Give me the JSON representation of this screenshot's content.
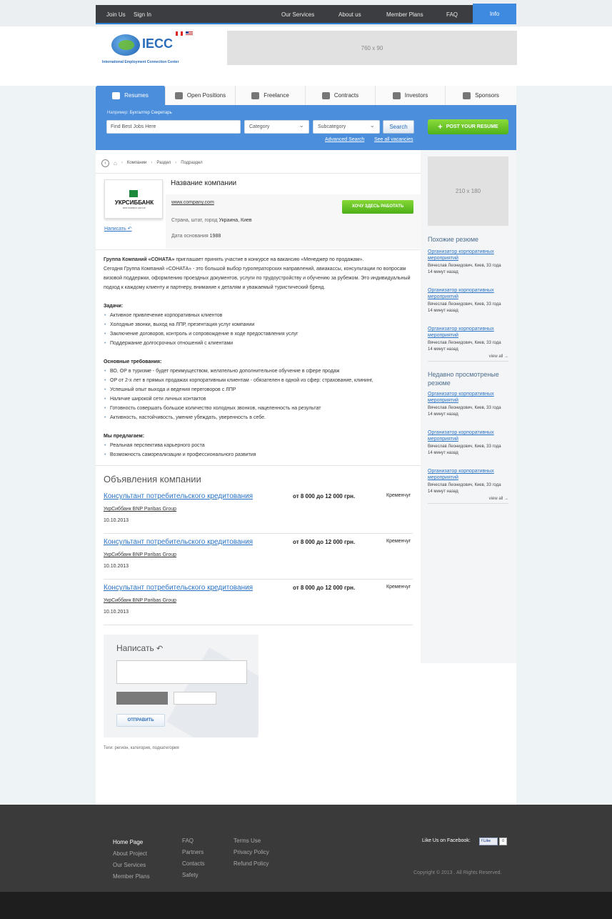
{
  "topnav": {
    "left": [
      "Join Us",
      "Sign In"
    ],
    "right": [
      "Our Services",
      "About us",
      "Member Plans",
      "FAQ"
    ],
    "info": "Info"
  },
  "header": {
    "logo_text": "IECC",
    "logo_sub": "International Employment Connection Center",
    "banner": "760 x 90"
  },
  "tabs": [
    {
      "label": "Resumes",
      "icon": "resume-icon"
    },
    {
      "label": "Open Positions",
      "icon": "person-icon"
    },
    {
      "label": "Freelance",
      "icon": "freelance-icon"
    },
    {
      "label": "Contracts",
      "icon": "contract-icon"
    },
    {
      "label": "Investors",
      "icon": "bulb-icon"
    },
    {
      "label": "Sponsors",
      "icon": "handshake-icon"
    }
  ],
  "search": {
    "hint_prefix": "Например:",
    "hint_1": "Бухгалтер",
    "hint_2": "Секретарь",
    "placeholder": "Find Best Jobs Here",
    "category": "Category",
    "subcategory": "Subcategory",
    "button": "Search",
    "advanced": "Advanced Search",
    "see_all": "See all vacancies",
    "post": "POST YOUR RESUME"
  },
  "breadcrumb": [
    "Компании",
    "Раздел",
    "Подраздел"
  ],
  "company": {
    "logo_name": "УКРСИББАНК",
    "logo_sub": "BNP PARIBAS GROUP",
    "write": "Написать",
    "name": "Название компании",
    "site": "www.company.com",
    "loc_label": "Страна, штат, город",
    "loc_value": "Украина, Киев",
    "date_label": "Дата основания",
    "date_value": "1988",
    "button": "ХОЧУ ЗДЕСЬ РАБОТАТЬ"
  },
  "description": {
    "intro_bold": "Группа Компаний «СОНАТА»",
    "intro_rest": " приглашает принять участие в конкурсе на вакансию «Менеджер по продажам».",
    "para": "Сегодня Группа Компаний «СОНАТА» - это большой выбор туроператорских направлений, авиакассы, консультации по вопросам визовой поддержки, оформлению проездных документов, услуги по трудоустройству и обучению за рубежом. Это индивидуальный подход к каждому клиенту и партнеру, внимание к деталям и уважаемый туристический бренд.",
    "tasks_title": "Задачи:",
    "tasks": [
      "Активное привлечение корпоративных клиентов",
      "Холодные звонки, выход на ЛПР, презентация услуг компании",
      "Заключение договоров, контроль и сопровождение в ходе предоставления услуг",
      "Поддержание долгосрочных отношений с клиентами"
    ],
    "req_title": "Основные требования:",
    "req": [
      "ВО, ОР в туризме - будет преимуществом, желательно дополнительное обучение в сфере продаж",
      "ОР от 2-х лет в прямых продажах корпоративным клиентам - обязателен в одной из сфер: страхование, клининг,",
      "Успешный опыт выхода и ведения переговоров с ЛПР",
      "Наличие широкой сети личных контактов",
      "Готовность совершать большое количество холодных звонков, нацеленность на результат",
      "Активность, настойчивость, умение убеждать, уверенность в себе."
    ],
    "offer_title": "Мы предлагаем:",
    "offer": [
      "Реальная перспектива карьерного роста",
      "Возможность самореализации и профессионального развития"
    ]
  },
  "announcements": {
    "title": "Объявления компании",
    "items": [
      {
        "title": "Консультант потребительского кредитования",
        "salary": "от 8 000 до 12 000 грн.",
        "city": "Кременчуг",
        "company": "УкрСиббанк BNP Paribas Group",
        "date": "10.10.2013"
      },
      {
        "title": "Консультант потребительского кредитования",
        "salary": "от 8 000 до 12 000 грн.",
        "city": "Кременчуг",
        "company": "УкрСиббанк BNP Paribas Group",
        "date": "10.10.2013"
      },
      {
        "title": "Консультант потребительского кредитования",
        "salary": "от 8 000 до 12 000 грн.",
        "city": "Кременчуг",
        "company": "УкрСиббанк BNP Paribas Group",
        "date": "10.10.2013"
      }
    ]
  },
  "form": {
    "title": "Написать",
    "send": "ОТПРАВИТЬ",
    "tags": "Теги: регион, категория, подкатегория"
  },
  "sidebar": {
    "ad": "210 x 180",
    "similar_title": "Похожие резюме",
    "recent_title": "Недавно просмотреные резюме",
    "view_all": "view all →",
    "similar": [
      {
        "title": "Организатор корпоративных мероприятий",
        "meta1": "Вячеслав Леонидович, Киев, 33 года",
        "meta2": "14 минут назад"
      },
      {
        "title": "Организатор корпоративных мероприятий",
        "meta1": "Вячеслав Леонидович, Киев, 33 года",
        "meta2": "14 минут назад"
      },
      {
        "title": "Организатор корпоративных мероприятий",
        "meta1": "Вячеслав Леонидович, Киев, 33 года",
        "meta2": "14 минут назад"
      }
    ],
    "recent": [
      {
        "title": "Организатор корпоративных мероприятий",
        "meta1": "Вячеслав Леонидович, Киев, 33 года",
        "meta2": "14 минут назад"
      },
      {
        "title": "Организатор корпоративных мероприятий",
        "meta1": "Вячеслав Леонидович, Киев, 33 года",
        "meta2": "14 минут назад"
      },
      {
        "title": "Организатор корпоративных мероприятий",
        "meta1": "Вячеслав Леонидович, Киев, 33 года",
        "meta2": "14 минут назад"
      }
    ]
  },
  "footer": {
    "col1": [
      "Home Page",
      "About Project",
      "Our Services",
      "Member Plans"
    ],
    "col2": [
      "FAQ",
      "Partners",
      "Contacts",
      "Safety"
    ],
    "col3": [
      "Terms Use",
      "Privacy Policy",
      "Refund Policy"
    ],
    "like_label": "Like Us on Facebook:",
    "fb_btn": "f Like",
    "fb_count": "0",
    "copyright": "Copyright © 2013 . All Rights Reserved."
  }
}
